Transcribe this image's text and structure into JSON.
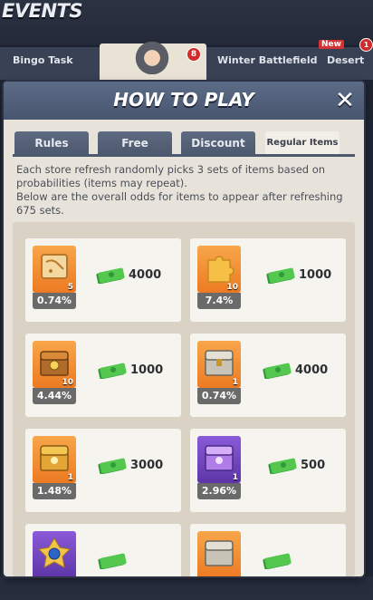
{
  "header": {
    "events_title": "EVENTS",
    "tabs": [
      "Bingo Task",
      "Winter Battlefield",
      "Desert"
    ],
    "active_tab_badge": "8",
    "new_badge": "New",
    "desert_badge": "1"
  },
  "modal": {
    "title": "HOW TO PLAY",
    "close_symbol": "✕",
    "tabs": [
      "Rules",
      "Free",
      "Discount",
      "Regular Items"
    ],
    "active_tab_index": 3,
    "description": [
      "Each store refresh randomly picks 3 sets of items based on",
      "probabilities (items may repeat).",
      "Below are the overall odds for items to appear after refreshing",
      "675 sets."
    ]
  },
  "items": [
    {
      "icon": "map-scroll-icon",
      "qty": "5",
      "odds": "0.74%",
      "price": "4000",
      "bg": "orange"
    },
    {
      "icon": "puzzle-piece-icon",
      "qty": "10",
      "odds": "7.4%",
      "price": "1000",
      "bg": "orange"
    },
    {
      "icon": "treasure-chest-icon",
      "qty": "10",
      "odds": "4.44%",
      "price": "1000",
      "bg": "orange"
    },
    {
      "icon": "silver-chest-icon",
      "qty": "1",
      "odds": "0.74%",
      "price": "4000",
      "bg": "orange"
    },
    {
      "icon": "gold-chest-icon",
      "qty": "1",
      "odds": "1.48%",
      "price": "3000",
      "bg": "orange"
    },
    {
      "icon": "purple-chest-icon",
      "qty": "1",
      "odds": "2.96%",
      "price": "500",
      "bg": "purple"
    },
    {
      "icon": "blue-gem-badge-icon",
      "qty": "",
      "odds": "",
      "price": "",
      "bg": "purple"
    },
    {
      "icon": "silver-chest-icon",
      "qty": "",
      "odds": "",
      "price": "",
      "bg": "orange"
    }
  ],
  "colors": {
    "modal_bg": "#e8e3da",
    "header_bg": "#5c6b86",
    "cash_green": "#3dbb3d",
    "odds_bg": "#6b6a6a"
  }
}
